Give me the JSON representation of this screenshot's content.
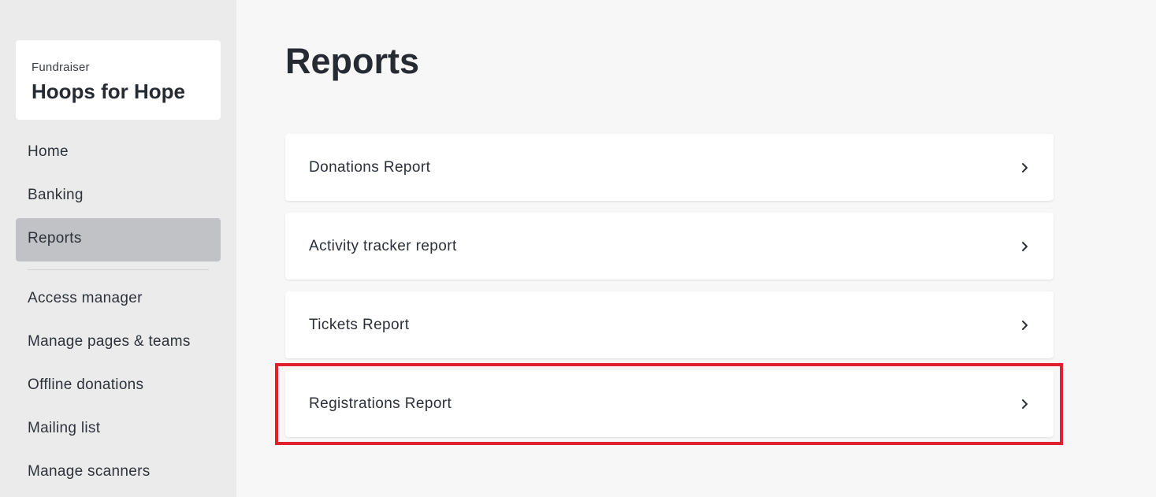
{
  "sidebar": {
    "org_label": "Fundraiser",
    "org_name": "Hoops for Hope",
    "items": [
      {
        "label": "Home",
        "active": false
      },
      {
        "label": "Banking",
        "active": false
      },
      {
        "label": "Reports",
        "active": true
      },
      {
        "label": "Access manager",
        "active": false
      },
      {
        "label": "Manage pages & teams",
        "active": false
      },
      {
        "label": "Offline donations",
        "active": false
      },
      {
        "label": "Mailing list",
        "active": false
      },
      {
        "label": "Manage scanners",
        "active": false
      }
    ]
  },
  "main": {
    "title": "Reports",
    "reports": [
      {
        "label": "Donations Report",
        "icon": "chevron-right-icon"
      },
      {
        "label": "Activity tracker report",
        "icon": "chevron-right-icon"
      },
      {
        "label": "Tickets Report",
        "icon": "chevron-right-icon"
      },
      {
        "label": "Registrations Report",
        "icon": "chevron-right-icon",
        "highlighted": true
      }
    ]
  },
  "colors": {
    "sidebar_bg": "#ebebec",
    "active_item_bg": "#c1c2c5",
    "page_bg": "#f7f7f8",
    "highlight_border": "#e0202e"
  }
}
